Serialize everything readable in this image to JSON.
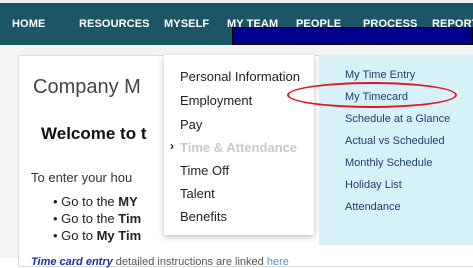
{
  "nav": {
    "items": [
      "HOME",
      "RESOURCES",
      "MYSELF",
      "MY TEAM",
      "PEOPLE",
      "PROCESS",
      "REPORTING"
    ]
  },
  "main": {
    "company_title": "Company M",
    "welcome": "Welcome to t",
    "enter_text": "To enter your hou",
    "bullets": [
      {
        "prefix": "Go to the ",
        "bold": "MY"
      },
      {
        "prefix": "Go to the ",
        "bold": "Tim"
      },
      {
        "prefix": "Go to ",
        "bold": "My Tim"
      }
    ],
    "footer": {
      "emphasis": "Time card entry",
      "text": " detailed instructions are linked ",
      "link": "here"
    }
  },
  "myself_menu": {
    "items": [
      "Personal Information",
      "Employment",
      "Pay",
      "Time & Attendance",
      "Time Off",
      "Talent",
      "Benefits"
    ],
    "active_item": "Time & Attendance"
  },
  "time_submenu": {
    "items": [
      "My Time Entry",
      "My Timecard",
      "Schedule at a Glance",
      "Actual vs Scheduled",
      "Monthly Schedule",
      "Holiday List",
      "Attendance"
    ],
    "highlighted": "My Timecard"
  },
  "colors": {
    "navbar": "#1c5566",
    "submenu_bg": "#d6f2f8",
    "annotation_oval": "#e0191e",
    "redaction": "#00008b"
  }
}
